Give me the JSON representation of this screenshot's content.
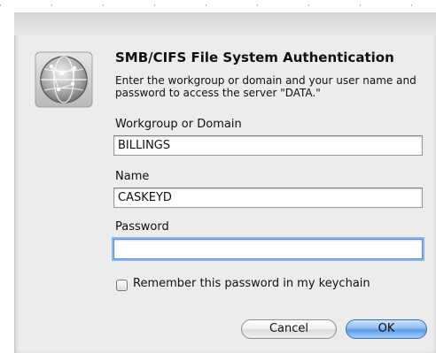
{
  "dialog": {
    "title": "SMB/CIFS File System Authentication",
    "description": "Enter the workgroup or domain and your user name and password to access the server \"DATA.\"",
    "icon": "network-globe-icon"
  },
  "fields": {
    "workgroup": {
      "label": "Workgroup or Domain",
      "value": "BILLINGS"
    },
    "name": {
      "label": "Name",
      "value": "CASKEYD"
    },
    "password": {
      "label": "Password",
      "value": ""
    }
  },
  "remember": {
    "label": "Remember this password in my keychain",
    "checked": false
  },
  "buttons": {
    "cancel": "Cancel",
    "ok": "OK"
  },
  "colors": {
    "sheet_background": "#ececec",
    "default_button": "#5e9be5",
    "focus_ring": "#8fb6ea"
  }
}
